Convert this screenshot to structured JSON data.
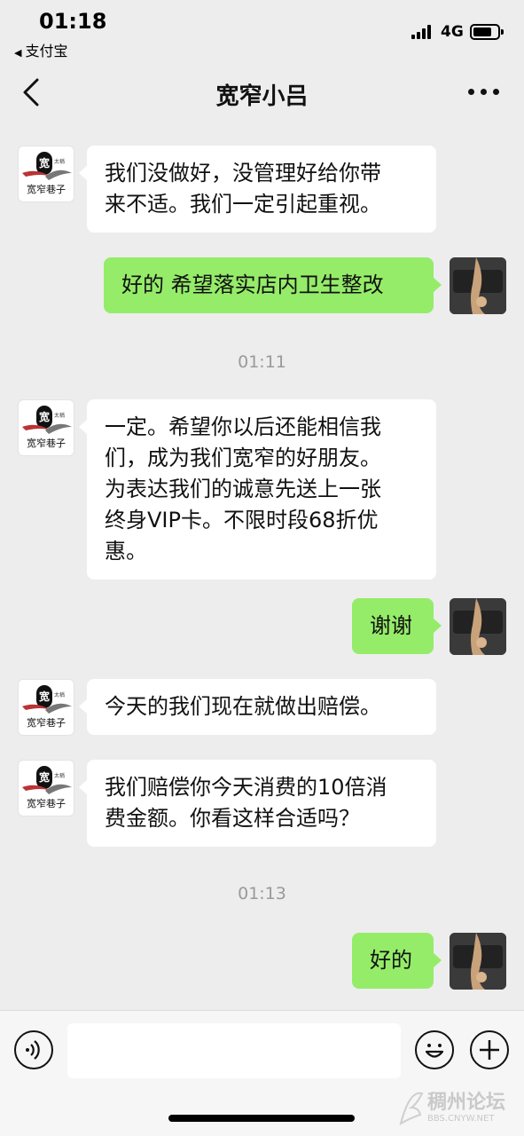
{
  "status_bar": {
    "time": "01:18",
    "back_app": "支付宝",
    "network": "4G"
  },
  "nav": {
    "title": "宽窄小吕"
  },
  "messages": [
    {
      "side": "left",
      "lines": [
        "我们没做好，没管理好给你带",
        "来不适。我们一定引起重视。"
      ]
    },
    {
      "side": "right",
      "lines": [
        "好的 希望落实店内卫生整改"
      ]
    },
    {
      "type": "time",
      "text": "01:11"
    },
    {
      "side": "left",
      "lines": [
        "一定。希望你以后还能相信我",
        "们，成为我们宽窄的好朋友。",
        "为表达我们的诚意先送上一张",
        "终身VIP卡。不限时段68折优",
        "惠。"
      ]
    },
    {
      "side": "right",
      "lines": [
        "谢谢"
      ]
    },
    {
      "side": "left",
      "lines": [
        "今天的我们现在就做出赔偿。"
      ]
    },
    {
      "side": "left",
      "lines": [
        "我们赔偿你今天消费的10倍消",
        "费金额。你看这样合适吗？"
      ]
    },
    {
      "type": "time",
      "text": "01:13"
    },
    {
      "side": "right",
      "lines": [
        "好的"
      ]
    }
  ],
  "shop_avatar": {
    "logo_char": "宽",
    "side_text": "太稱",
    "bottom_text": "宽窄巷子"
  },
  "watermark": {
    "main": "稠州论坛",
    "sub": "BBS.CNYW.NET"
  },
  "colors": {
    "background": "#ededed",
    "incoming_bubble": "#ffffff",
    "outgoing_bubble": "#95ec69",
    "timestamp": "#9a9a9a"
  }
}
